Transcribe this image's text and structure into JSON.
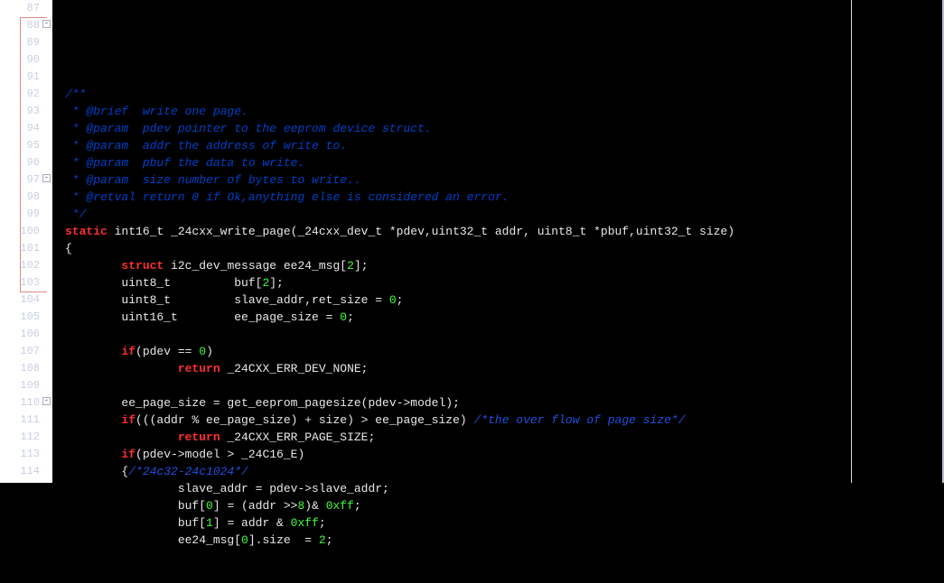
{
  "lines": [
    {
      "num": "87",
      "fold": "",
      "segs": []
    },
    {
      "num": "88",
      "fold": "-",
      "segs": [
        {
          "cls": "comment-blue",
          "t": "/**"
        }
      ]
    },
    {
      "num": "89",
      "fold": "",
      "segs": [
        {
          "cls": "comment-blue",
          "t": " * @brief  write one page."
        }
      ]
    },
    {
      "num": "90",
      "fold": "",
      "segs": [
        {
          "cls": "comment-blue",
          "t": " * @param  pdev pointer to the eeprom device struct."
        }
      ]
    },
    {
      "num": "91",
      "fold": "",
      "segs": [
        {
          "cls": "comment-blue",
          "t": " * @param  addr the address of write to."
        }
      ]
    },
    {
      "num": "92",
      "fold": "",
      "segs": [
        {
          "cls": "comment-blue",
          "t": " * @param  pbuf the data to write."
        }
      ]
    },
    {
      "num": "93",
      "fold": "",
      "segs": [
        {
          "cls": "comment-blue",
          "t": " * @param  size number of bytes to write.."
        }
      ]
    },
    {
      "num": "94",
      "fold": "",
      "segs": [
        {
          "cls": "comment-blue",
          "t": " * @retval return 0 if Ok,anything else is considered an error."
        }
      ]
    },
    {
      "num": "95",
      "fold": "",
      "segs": [
        {
          "cls": "comment-blue",
          "t": " */"
        }
      ]
    },
    {
      "num": "96",
      "fold": "",
      "segs": [
        {
          "cls": "kw-red",
          "t": "static"
        },
        {
          "cls": "txt",
          "t": " int16_t _24cxx_write_page(_24cxx_dev_t *pdev,uint32_t addr, uint8_t *pbuf,uint32_t size)"
        }
      ]
    },
    {
      "num": "97",
      "fold": "-",
      "segs": [
        {
          "cls": "txt",
          "t": "{"
        }
      ]
    },
    {
      "num": "98",
      "fold": "",
      "segs": [
        {
          "cls": "txt",
          "t": "        "
        },
        {
          "cls": "kw-red",
          "t": "struct"
        },
        {
          "cls": "txt",
          "t": " i2c_dev_message ee24_msg["
        },
        {
          "cls": "num",
          "t": "2"
        },
        {
          "cls": "txt",
          "t": "];"
        }
      ]
    },
    {
      "num": "99",
      "fold": "",
      "segs": [
        {
          "cls": "txt",
          "t": "        uint8_t         buf["
        },
        {
          "cls": "num",
          "t": "2"
        },
        {
          "cls": "txt",
          "t": "];"
        }
      ]
    },
    {
      "num": "100",
      "fold": "",
      "segs": [
        {
          "cls": "txt",
          "t": "        uint8_t         slave_addr,ret_size = "
        },
        {
          "cls": "num",
          "t": "0"
        },
        {
          "cls": "txt",
          "t": ";"
        }
      ]
    },
    {
      "num": "101",
      "fold": "",
      "segs": [
        {
          "cls": "txt",
          "t": "        uint16_t        ee_page_size = "
        },
        {
          "cls": "num",
          "t": "0"
        },
        {
          "cls": "txt",
          "t": ";"
        }
      ]
    },
    {
      "num": "102",
      "fold": "",
      "segs": []
    },
    {
      "num": "103",
      "fold": "",
      "segs": [
        {
          "cls": "txt",
          "t": "        "
        },
        {
          "cls": "kw-red",
          "t": "if"
        },
        {
          "cls": "txt",
          "t": "(pdev == "
        },
        {
          "cls": "num",
          "t": "0"
        },
        {
          "cls": "txt",
          "t": ")"
        }
      ]
    },
    {
      "num": "104",
      "fold": "",
      "segs": [
        {
          "cls": "txt",
          "t": "                "
        },
        {
          "cls": "kw-red",
          "t": "return"
        },
        {
          "cls": "txt",
          "t": " _24CXX_ERR_DEV_NONE;"
        }
      ]
    },
    {
      "num": "105",
      "fold": "",
      "segs": []
    },
    {
      "num": "106",
      "fold": "",
      "segs": [
        {
          "cls": "txt",
          "t": "        ee_page_size = get_eeprom_pagesize(pdev->model);"
        }
      ]
    },
    {
      "num": "107",
      "fold": "",
      "segs": [
        {
          "cls": "txt",
          "t": "        "
        },
        {
          "cls": "kw-red",
          "t": "if"
        },
        {
          "cls": "txt",
          "t": "(((addr % ee_page_size) + size) > ee_page_size) "
        },
        {
          "cls": "comment-blue2",
          "t": "/*the over flow of page size*/"
        }
      ]
    },
    {
      "num": "108",
      "fold": "",
      "segs": [
        {
          "cls": "txt",
          "t": "                "
        },
        {
          "cls": "kw-red",
          "t": "return"
        },
        {
          "cls": "txt",
          "t": " _24CXX_ERR_PAGE_SIZE;"
        }
      ]
    },
    {
      "num": "109",
      "fold": "",
      "segs": [
        {
          "cls": "txt",
          "t": "        "
        },
        {
          "cls": "kw-red",
          "t": "if"
        },
        {
          "cls": "txt",
          "t": "(pdev->model > _24C16_E)"
        }
      ]
    },
    {
      "num": "110",
      "fold": "-",
      "segs": [
        {
          "cls": "txt",
          "t": "        {"
        },
        {
          "cls": "comment-blue2",
          "t": "/*24c32-24c1024*/"
        }
      ]
    },
    {
      "num": "111",
      "fold": "",
      "segs": [
        {
          "cls": "txt",
          "t": "                slave_addr = pdev->slave_addr;"
        }
      ]
    },
    {
      "num": "112",
      "fold": "",
      "segs": [
        {
          "cls": "txt",
          "t": "                buf["
        },
        {
          "cls": "num",
          "t": "0"
        },
        {
          "cls": "txt",
          "t": "] = (addr >>"
        },
        {
          "cls": "num",
          "t": "8"
        },
        {
          "cls": "txt",
          "t": ")& "
        },
        {
          "cls": "kw-green",
          "t": "0xff"
        },
        {
          "cls": "txt",
          "t": ";"
        }
      ]
    },
    {
      "num": "113",
      "fold": "",
      "segs": [
        {
          "cls": "txt",
          "t": "                buf["
        },
        {
          "cls": "num",
          "t": "1"
        },
        {
          "cls": "txt",
          "t": "] = addr & "
        },
        {
          "cls": "kw-green",
          "t": "0xff"
        },
        {
          "cls": "txt",
          "t": ";"
        }
      ]
    },
    {
      "num": "114",
      "fold": "",
      "segs": [
        {
          "cls": "txt",
          "t": "                ee24_msg["
        },
        {
          "cls": "num",
          "t": "0"
        },
        {
          "cls": "txt",
          "t": "].size  = "
        },
        {
          "cls": "num",
          "t": "2"
        },
        {
          "cls": "txt",
          "t": ";"
        }
      ]
    }
  ]
}
